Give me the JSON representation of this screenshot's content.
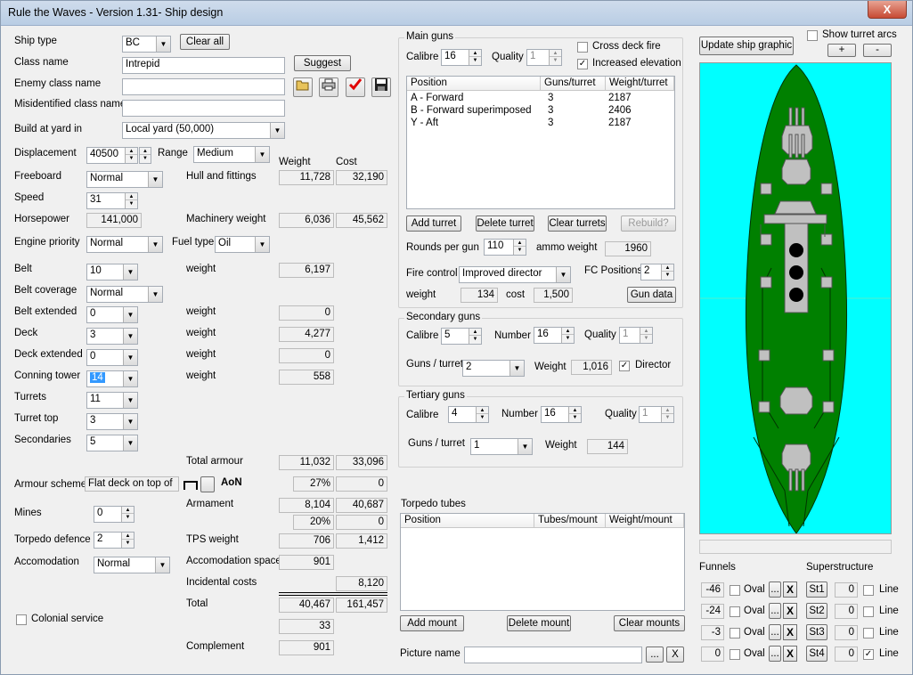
{
  "window": {
    "title": "Rule the Waves - Version 1.31- Ship design",
    "close_glyph": "X"
  },
  "left": {
    "ship_type": {
      "label": "Ship type",
      "value": "BC"
    },
    "clear_all": "Clear all",
    "class_name": {
      "label": "Class name",
      "value": "Intrepid"
    },
    "suggest": "Suggest",
    "enemy_class": {
      "label": "Enemy class name",
      "value": ""
    },
    "misidentified": {
      "label": "Misidentified class name",
      "value": ""
    },
    "build_yard": {
      "label": "Build at yard in",
      "value": "Local yard (50,000)"
    },
    "displacement": {
      "label": "Displacement",
      "value": "40500"
    },
    "range": {
      "label": "Range",
      "value": "Medium"
    },
    "col_weight": "Weight",
    "col_cost": "Cost",
    "freeboard": {
      "label": "Freeboard",
      "value": "Normal"
    },
    "hull": {
      "label": "Hull and fittings",
      "weight": "11,728",
      "cost": "32,190"
    },
    "speed": {
      "label": "Speed",
      "value": "31"
    },
    "horsepower": {
      "label": "Horsepower",
      "value": "141,000"
    },
    "machinery": {
      "label": "Machinery weight",
      "weight": "6,036",
      "cost": "45,562"
    },
    "engine_priority": {
      "label": "Engine priority",
      "value": "Normal"
    },
    "fuel_type": {
      "label": "Fuel type",
      "value": "Oil"
    },
    "belt": {
      "label": "Belt",
      "value": "10",
      "weight_label": "weight",
      "weight": "6,197"
    },
    "belt_coverage": {
      "label": "Belt coverage",
      "value": "Normal"
    },
    "belt_extended": {
      "label": "Belt extended",
      "value": "0",
      "weight_label": "weight",
      "weight": "0"
    },
    "deck": {
      "label": "Deck",
      "value": "3",
      "weight_label": "weight",
      "weight": "4,277"
    },
    "deck_extended": {
      "label": "Deck extended",
      "value": "0",
      "weight_label": "weight",
      "weight": "0"
    },
    "conning_tower": {
      "label": "Conning tower",
      "value": "14",
      "weight_label": "weight",
      "weight": "558"
    },
    "turrets": {
      "label": "Turrets",
      "value": "11"
    },
    "turret_top": {
      "label": "Turret top",
      "value": "3"
    },
    "secondaries": {
      "label": "Secondaries",
      "value": "5"
    },
    "total_armour": {
      "label": "Total armour",
      "weight": "11,032",
      "cost": "33,096"
    },
    "armour_scheme": {
      "label": "Armour scheme",
      "value": "Flat deck on top of",
      "aon": "AoN",
      "pct": "27%",
      "cost": "0"
    },
    "mines": {
      "label": "Mines",
      "value": "0"
    },
    "armament": {
      "label": "Armament",
      "weight": "8,104",
      "cost": "40,687"
    },
    "torp_pct": {
      "pct": "20%",
      "cost": "0"
    },
    "torpedo_defence": {
      "label": "Torpedo defence",
      "value": "2"
    },
    "tps": {
      "label": "TPS weight",
      "weight": "706",
      "cost": "1,412"
    },
    "accomodation": {
      "label": "Accomodation",
      "value": "Normal"
    },
    "acc_space": {
      "label": "Accomodation space",
      "value": "901"
    },
    "incidental": {
      "label": "Incidental costs",
      "value": "8,120"
    },
    "total": {
      "label": "Total",
      "weight": "40,467",
      "cost": "161,457"
    },
    "colonial": {
      "label": "Colonial service",
      "value": "33"
    },
    "complement": {
      "label": "Complement",
      "value": "901"
    }
  },
  "main_guns": {
    "caption": "Main guns",
    "calibre": {
      "label": "Calibre",
      "value": "16"
    },
    "quality": {
      "label": "Quality",
      "value": "1"
    },
    "cross_deck": "Cross deck fire",
    "increased_elev": "Increased elevation",
    "headers": [
      "Position",
      "Guns/turret",
      "Weight/turret"
    ],
    "rows": [
      {
        "pos": "A - Forward",
        "guns": "3",
        "weight": "2187"
      },
      {
        "pos": "B - Forward superimposed",
        "guns": "3",
        "weight": "2406"
      },
      {
        "pos": "Y - Aft",
        "guns": "3",
        "weight": "2187"
      }
    ],
    "add_turret": "Add turret",
    "delete_turret": "Delete turret",
    "clear_turrets": "Clear turrets",
    "rebuild": "Rebuild?",
    "rounds": {
      "label": "Rounds per gun",
      "value": "110"
    },
    "ammo": {
      "label": "ammo weight",
      "value": "1960"
    },
    "fire_control": {
      "label": "Fire control",
      "value": "Improved director"
    },
    "fc_positions": {
      "label": "FC Positions",
      "value": "2"
    },
    "fc_weight": {
      "label": "weight",
      "value": "134"
    },
    "fc_cost": {
      "label": "cost",
      "value": "1,500"
    },
    "gun_data": "Gun data"
  },
  "secondary": {
    "caption": "Secondary guns",
    "calibre": {
      "label": "Calibre",
      "value": "5"
    },
    "number": {
      "label": "Number",
      "value": "16"
    },
    "quality": {
      "label": "Quality",
      "value": "1"
    },
    "guns_turret": {
      "label": "Guns / turret",
      "value": "2"
    },
    "weight": {
      "label": "Weight",
      "value": "1,016"
    },
    "director": "Director"
  },
  "tertiary": {
    "caption": "Tertiary guns",
    "calibre": {
      "label": "Calibre",
      "value": "4"
    },
    "number": {
      "label": "Number",
      "value": "16"
    },
    "quality": {
      "label": "Quality",
      "value": "1"
    },
    "guns_turret": {
      "label": "Guns / turret",
      "value": "1"
    },
    "weight": {
      "label": "Weight",
      "value": "144"
    }
  },
  "torpedo": {
    "caption": "Torpedo tubes",
    "headers": [
      "Position",
      "Tubes/mount",
      "Weight/mount"
    ],
    "add_mount": "Add mount",
    "delete_mount": "Delete mount",
    "clear_mounts": "Clear mounts"
  },
  "picture": {
    "label": "Picture name",
    "value": "",
    "browse": "...",
    "clear": "X"
  },
  "right": {
    "update_graphic": "Update ship graphic",
    "show_arcs": "Show turret arcs",
    "plus": "+",
    "minus": "-",
    "funnels_label": "Funnels",
    "super_label": "Superstructure",
    "oval": "Oval",
    "line": "Line",
    "dots": "...",
    "x": "X",
    "funnels": [
      "-46",
      "-24",
      "-3",
      "0"
    ],
    "super": [
      {
        "name": "St1",
        "value": "0"
      },
      {
        "name": "St2",
        "value": "0"
      },
      {
        "name": "St3",
        "value": "0"
      },
      {
        "name": "St4",
        "value": "0"
      }
    ]
  },
  "colors": {
    "sea": "#00ffff",
    "hull": "#008000",
    "deck": "#c0c0c0",
    "funnel": "#000000"
  }
}
